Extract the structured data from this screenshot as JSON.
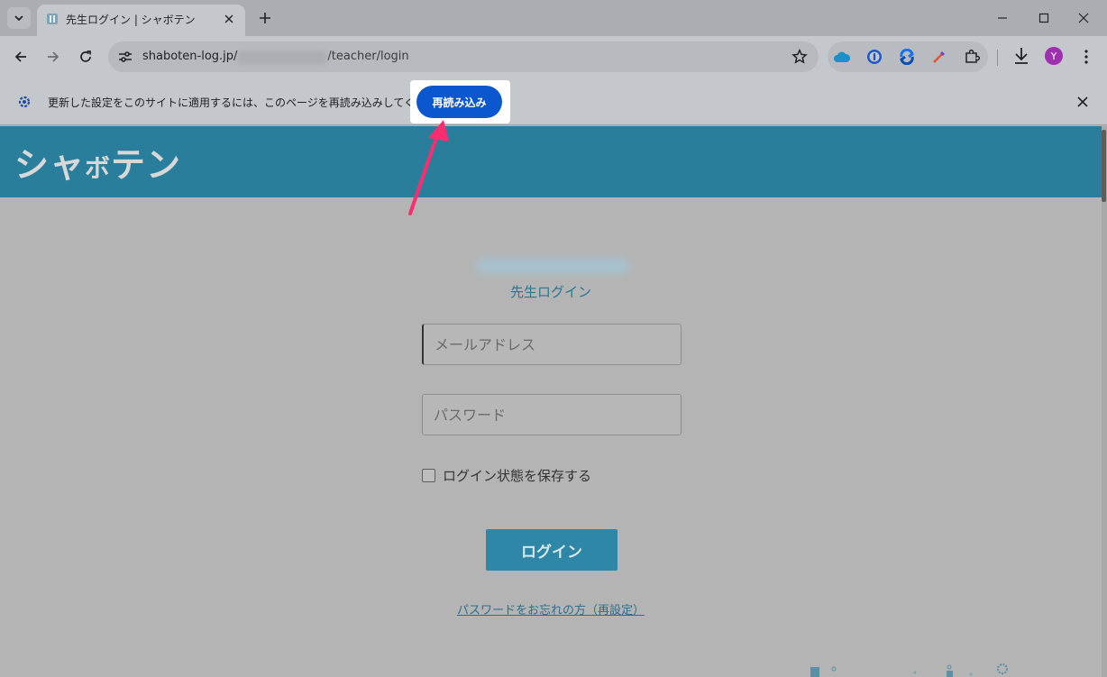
{
  "browser": {
    "tab": {
      "title": "先生ログイン | シャボテン",
      "favicon": "site-favicon"
    },
    "address": {
      "domain": "shaboten-log.jp/",
      "path": "/teacher/login"
    },
    "avatar_letter": "Y",
    "colors": {
      "accent": "#0b57d0",
      "avatar": "#9e2fae"
    }
  },
  "infobar": {
    "message": "更新した設定をこのサイトに適用するには、このページを再読み込みしてください",
    "reload_label": "再読み込み"
  },
  "site": {
    "logo": {
      "part1": "シャ",
      "part2": "ボ",
      "part3": "テン"
    },
    "page_title": "先生ログイン",
    "email_placeholder": "メールアドレス",
    "password_placeholder": "パスワード",
    "remember_label": "ログイン状態を保存する",
    "login_label": "ログイン",
    "forgot_link": "パスワードをお忘れの方（再設定）",
    "colors": {
      "header": "#287e9b",
      "button": "#2e87a7"
    }
  },
  "annotation": {
    "color": "#ff2d6f"
  }
}
